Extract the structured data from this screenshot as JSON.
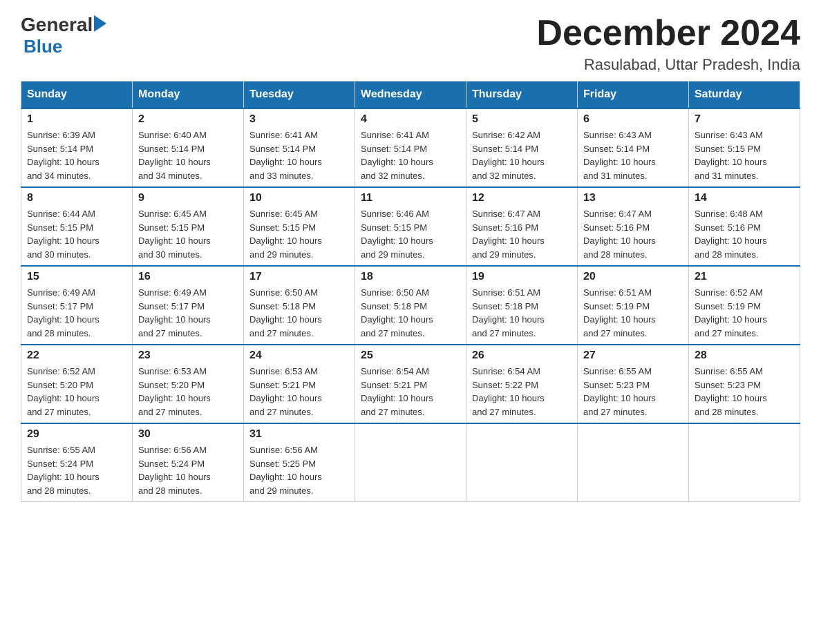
{
  "header": {
    "logo_general": "General",
    "logo_blue": "Blue",
    "month_title": "December 2024",
    "location": "Rasulabad, Uttar Pradesh, India"
  },
  "weekdays": [
    "Sunday",
    "Monday",
    "Tuesday",
    "Wednesday",
    "Thursday",
    "Friday",
    "Saturday"
  ],
  "weeks": [
    [
      {
        "day": "1",
        "sunrise": "6:39 AM",
        "sunset": "5:14 PM",
        "daylight": "10 hours and 34 minutes."
      },
      {
        "day": "2",
        "sunrise": "6:40 AM",
        "sunset": "5:14 PM",
        "daylight": "10 hours and 34 minutes."
      },
      {
        "day": "3",
        "sunrise": "6:41 AM",
        "sunset": "5:14 PM",
        "daylight": "10 hours and 33 minutes."
      },
      {
        "day": "4",
        "sunrise": "6:41 AM",
        "sunset": "5:14 PM",
        "daylight": "10 hours and 32 minutes."
      },
      {
        "day": "5",
        "sunrise": "6:42 AM",
        "sunset": "5:14 PM",
        "daylight": "10 hours and 32 minutes."
      },
      {
        "day": "6",
        "sunrise": "6:43 AM",
        "sunset": "5:14 PM",
        "daylight": "10 hours and 31 minutes."
      },
      {
        "day": "7",
        "sunrise": "6:43 AM",
        "sunset": "5:15 PM",
        "daylight": "10 hours and 31 minutes."
      }
    ],
    [
      {
        "day": "8",
        "sunrise": "6:44 AM",
        "sunset": "5:15 PM",
        "daylight": "10 hours and 30 minutes."
      },
      {
        "day": "9",
        "sunrise": "6:45 AM",
        "sunset": "5:15 PM",
        "daylight": "10 hours and 30 minutes."
      },
      {
        "day": "10",
        "sunrise": "6:45 AM",
        "sunset": "5:15 PM",
        "daylight": "10 hours and 29 minutes."
      },
      {
        "day": "11",
        "sunrise": "6:46 AM",
        "sunset": "5:15 PM",
        "daylight": "10 hours and 29 minutes."
      },
      {
        "day": "12",
        "sunrise": "6:47 AM",
        "sunset": "5:16 PM",
        "daylight": "10 hours and 29 minutes."
      },
      {
        "day": "13",
        "sunrise": "6:47 AM",
        "sunset": "5:16 PM",
        "daylight": "10 hours and 28 minutes."
      },
      {
        "day": "14",
        "sunrise": "6:48 AM",
        "sunset": "5:16 PM",
        "daylight": "10 hours and 28 minutes."
      }
    ],
    [
      {
        "day": "15",
        "sunrise": "6:49 AM",
        "sunset": "5:17 PM",
        "daylight": "10 hours and 28 minutes."
      },
      {
        "day": "16",
        "sunrise": "6:49 AM",
        "sunset": "5:17 PM",
        "daylight": "10 hours and 27 minutes."
      },
      {
        "day": "17",
        "sunrise": "6:50 AM",
        "sunset": "5:18 PM",
        "daylight": "10 hours and 27 minutes."
      },
      {
        "day": "18",
        "sunrise": "6:50 AM",
        "sunset": "5:18 PM",
        "daylight": "10 hours and 27 minutes."
      },
      {
        "day": "19",
        "sunrise": "6:51 AM",
        "sunset": "5:18 PM",
        "daylight": "10 hours and 27 minutes."
      },
      {
        "day": "20",
        "sunrise": "6:51 AM",
        "sunset": "5:19 PM",
        "daylight": "10 hours and 27 minutes."
      },
      {
        "day": "21",
        "sunrise": "6:52 AM",
        "sunset": "5:19 PM",
        "daylight": "10 hours and 27 minutes."
      }
    ],
    [
      {
        "day": "22",
        "sunrise": "6:52 AM",
        "sunset": "5:20 PM",
        "daylight": "10 hours and 27 minutes."
      },
      {
        "day": "23",
        "sunrise": "6:53 AM",
        "sunset": "5:20 PM",
        "daylight": "10 hours and 27 minutes."
      },
      {
        "day": "24",
        "sunrise": "6:53 AM",
        "sunset": "5:21 PM",
        "daylight": "10 hours and 27 minutes."
      },
      {
        "day": "25",
        "sunrise": "6:54 AM",
        "sunset": "5:21 PM",
        "daylight": "10 hours and 27 minutes."
      },
      {
        "day": "26",
        "sunrise": "6:54 AM",
        "sunset": "5:22 PM",
        "daylight": "10 hours and 27 minutes."
      },
      {
        "day": "27",
        "sunrise": "6:55 AM",
        "sunset": "5:23 PM",
        "daylight": "10 hours and 27 minutes."
      },
      {
        "day": "28",
        "sunrise": "6:55 AM",
        "sunset": "5:23 PM",
        "daylight": "10 hours and 28 minutes."
      }
    ],
    [
      {
        "day": "29",
        "sunrise": "6:55 AM",
        "sunset": "5:24 PM",
        "daylight": "10 hours and 28 minutes."
      },
      {
        "day": "30",
        "sunrise": "6:56 AM",
        "sunset": "5:24 PM",
        "daylight": "10 hours and 28 minutes."
      },
      {
        "day": "31",
        "sunrise": "6:56 AM",
        "sunset": "5:25 PM",
        "daylight": "10 hours and 29 minutes."
      },
      null,
      null,
      null,
      null
    ]
  ],
  "labels": {
    "sunrise": "Sunrise:",
    "sunset": "Sunset:",
    "daylight": "Daylight:"
  }
}
